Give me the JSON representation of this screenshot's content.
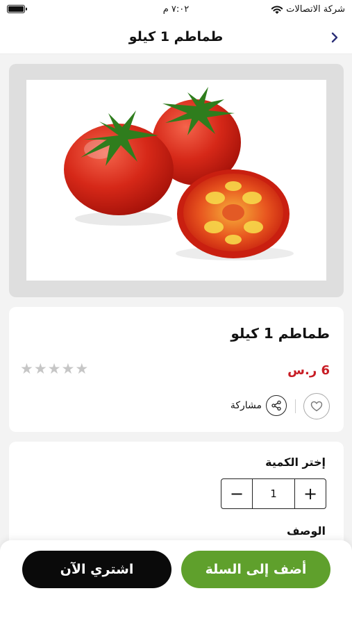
{
  "status_bar": {
    "time": "٧:٠٢ م",
    "carrier": "شركة الاتصالات"
  },
  "header": {
    "title": "طماطم 1 كيلو",
    "back_icon": "chevron-right-icon"
  },
  "product": {
    "image_icon": "tomato-image",
    "name": "طماطم 1 كيلو",
    "price": "6 ر.س",
    "rating": 0,
    "max_rating": 5,
    "share_label": "مشاركة"
  },
  "quantity": {
    "label": "إختر الكمية",
    "value": "1",
    "minus_symbol": "−",
    "plus_symbol": "+"
  },
  "description": {
    "label": "الوصف"
  },
  "actions": {
    "add_to_cart": "أضف إلى السلة",
    "buy_now": "اشتري الآن"
  },
  "colors": {
    "accent_green": "#5fa02c",
    "price_red": "#c81d25",
    "buy_black": "#0a0a0a",
    "header_chevron": "#2b2f77"
  }
}
